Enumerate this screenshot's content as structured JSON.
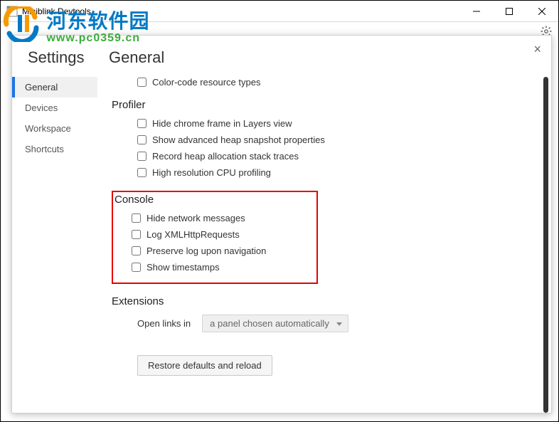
{
  "window": {
    "title": "Miniblink Devtools"
  },
  "watermark": {
    "cn": "河东软件园",
    "url": "www.pc0359.cn"
  },
  "settings": {
    "title": "Settings",
    "subtitle": "General",
    "close_glyph": "×",
    "nav": [
      {
        "label": "General",
        "active": true
      },
      {
        "label": "Devices",
        "active": false
      },
      {
        "label": "Workspace",
        "active": false
      },
      {
        "label": "Shortcuts",
        "active": false
      }
    ],
    "top_option": "Color-code resource types",
    "profiler": {
      "title": "Profiler",
      "options": [
        "Hide chrome frame in Layers view",
        "Show advanced heap snapshot properties",
        "Record heap allocation stack traces",
        "High resolution CPU profiling"
      ]
    },
    "console": {
      "title": "Console",
      "options": [
        "Hide network messages",
        "Log XMLHttpRequests",
        "Preserve log upon navigation",
        "Show timestamps"
      ]
    },
    "extensions": {
      "title": "Extensions",
      "open_links_label": "Open links in",
      "select_value": "a panel chosen automatically"
    },
    "restore_button": "Restore defaults and reload"
  }
}
